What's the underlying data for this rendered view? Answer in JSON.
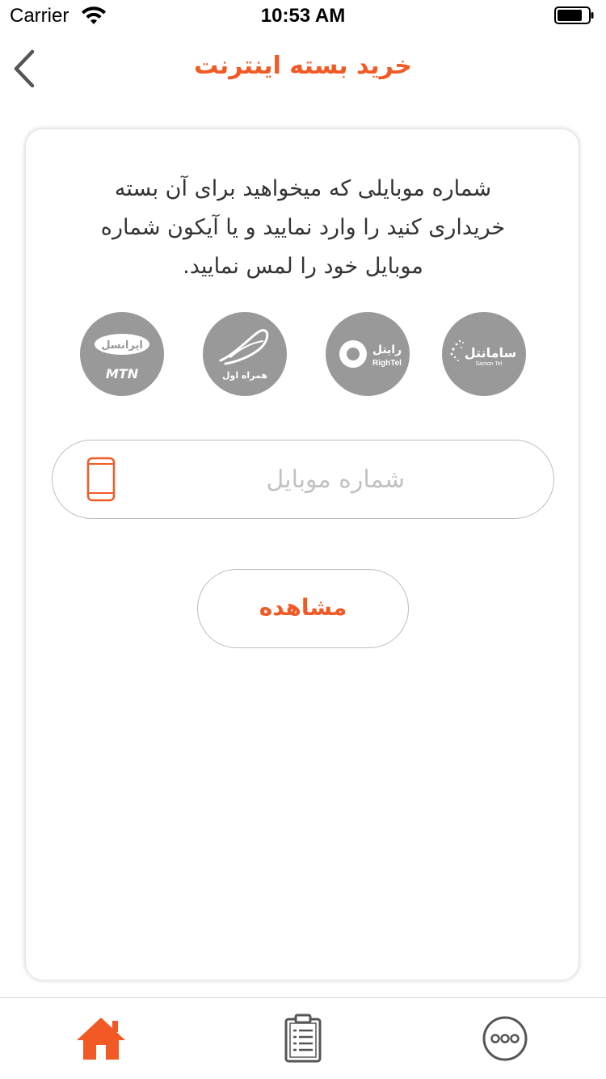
{
  "status_bar": {
    "carrier": "Carrier",
    "time": "10:53 AM"
  },
  "header": {
    "title": "خرید بسته اینترنت",
    "back_icon": "chevron-left-icon"
  },
  "card": {
    "instruction": "شماره موبایلی که میخواهید برای آن بسته خریداری کنید را وارد نمایید و یا آیکون شماره موبایل خود را لمس نمایید.",
    "operators": [
      {
        "name": "MTN Irancell",
        "logo_text": "ایرانسل",
        "logo_sub": "MTN"
      },
      {
        "name": "Hamrah Aval",
        "logo_text": "همراه اول",
        "logo_sub": ""
      },
      {
        "name": "RighTel",
        "logo_text": "رایتل",
        "logo_sub": "RighTel"
      },
      {
        "name": "SamanTel",
        "logo_text": "سامانتل",
        "logo_sub": "Samon Tel"
      }
    ],
    "phone_field": {
      "placeholder": "شماره موبایل",
      "value": "",
      "icon": "mobile-phone-icon"
    },
    "view_button_label": "مشاهده"
  },
  "tab_bar": {
    "items": [
      {
        "icon": "home-icon",
        "active": true
      },
      {
        "icon": "clipboard-list-icon",
        "active": false
      },
      {
        "icon": "more-dots-icon",
        "active": false
      }
    ]
  },
  "colors": {
    "accent": "#f15a24",
    "operator_bg": "#999999",
    "border": "#bdbdbd",
    "tab_inactive": "#555555"
  }
}
